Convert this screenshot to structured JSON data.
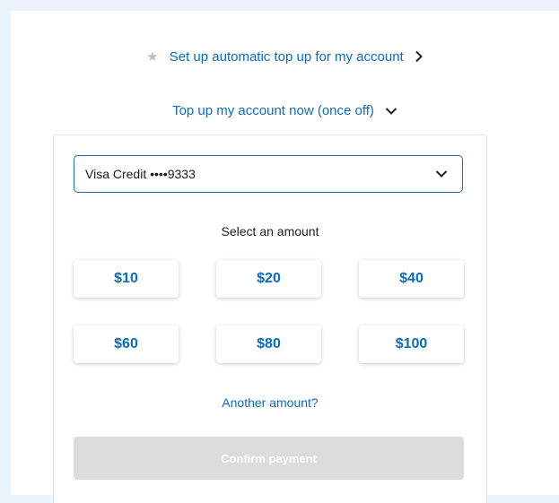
{
  "auto_topup": {
    "label": "Set up automatic top up for my account",
    "icon": "star-icon",
    "chevron": "chevron-right-icon"
  },
  "topup_now": {
    "label": "Top up my account now (once off)",
    "chevron": "chevron-down-icon",
    "expanded": true
  },
  "payment_method": {
    "selected": "Visa Credit ••••9333",
    "chevron": "chevron-down-icon"
  },
  "amount_section": {
    "label": "Select an amount",
    "amounts": [
      "$10",
      "$20",
      "$40",
      "$60",
      "$80",
      "$100"
    ]
  },
  "another_amount": "Another amount?",
  "confirm_button": {
    "label": "Confirm payment",
    "disabled": true
  },
  "colors": {
    "accent": "#0b6bbf",
    "background": "#ebf3fc",
    "disabled_button": "#dcdcdc"
  }
}
